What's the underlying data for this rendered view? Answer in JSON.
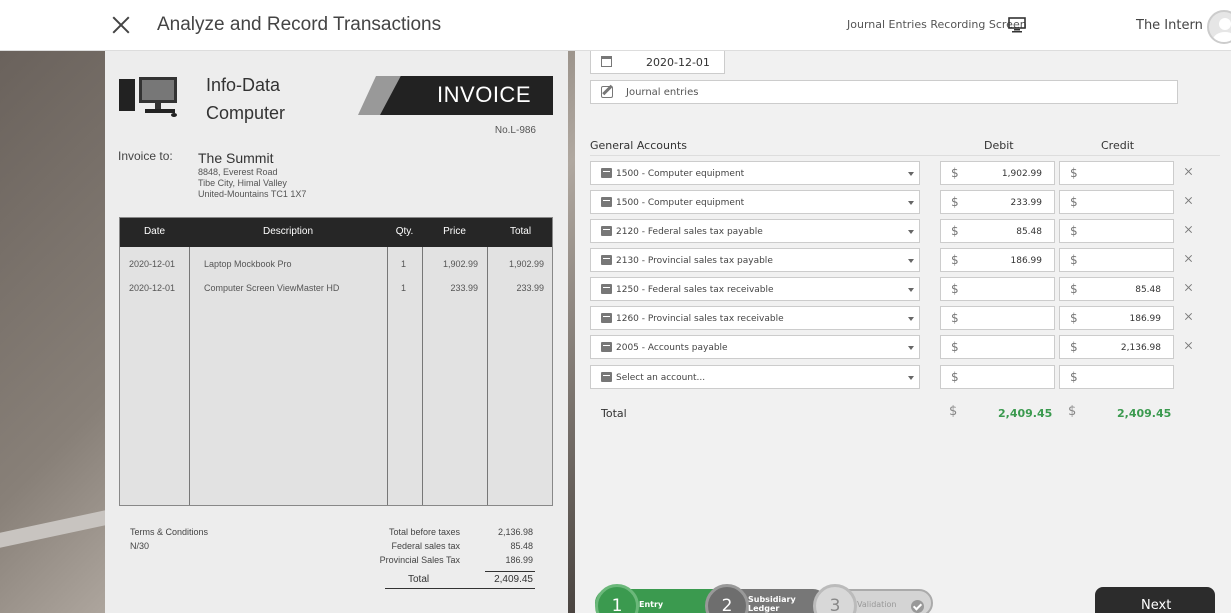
{
  "header": {
    "title": "Analyze and Record Transactions",
    "screen_label": "Journal Entries Recording Screen",
    "user_name": "The Intern"
  },
  "invoice": {
    "company_name": "Info-Data Computer",
    "banner": "INVOICE",
    "number": "No.L-986",
    "to_label": "Invoice to:",
    "to_name": "The Summit",
    "address": [
      "8848, Everest Road",
      "Tibe City, Himal Valley",
      "United-Mountains TC1 1X7"
    ],
    "columns": [
      "Date",
      "Description",
      "Qty.",
      "Price",
      "Total"
    ],
    "rows": [
      {
        "date": "2020-12-01",
        "description": "Laptop Mockbook Pro",
        "qty": "1",
        "price": "1,902.99",
        "total": "1,902.99"
      },
      {
        "date": "2020-12-01",
        "description": "Computer Screen ViewMaster HD",
        "qty": "1",
        "price": "233.99",
        "total": "233.99"
      }
    ],
    "terms_title": "Terms & Conditions",
    "terms": "N/30",
    "summary_labels": [
      "Total before taxes",
      "Federal sales tax",
      "Provincial Sales Tax"
    ],
    "summary_values": [
      "2,136.98",
      "85.48",
      "186.99"
    ],
    "total_label": "Total",
    "total_value": "2,409.45"
  },
  "entry": {
    "date": "2020-12-01",
    "description": "Journal entries",
    "col_accounts": "General Accounts",
    "col_debit": "Debit",
    "col_credit": "Credit",
    "currency": "$",
    "lines": [
      {
        "account": "1500 - Computer equipment",
        "debit": "1,902.99",
        "credit": ""
      },
      {
        "account": "1500 - Computer equipment",
        "debit": "233.99",
        "credit": ""
      },
      {
        "account": "2120 - Federal sales tax payable",
        "debit": "85.48",
        "credit": ""
      },
      {
        "account": "2130 - Provincial sales tax payable",
        "debit": "186.99",
        "credit": ""
      },
      {
        "account": "1250 - Federal sales tax receivable",
        "debit": "",
        "credit": "85.48"
      },
      {
        "account": "1260 - Provincial sales tax receivable",
        "debit": "",
        "credit": "186.99"
      },
      {
        "account": "2005 - Accounts payable",
        "debit": "",
        "credit": "2,136.98"
      }
    ],
    "empty_placeholder": "Select an account...",
    "total_label": "Total",
    "total_debit": "2,409.45",
    "total_credit": "2,409.45"
  },
  "stepper": {
    "steps": [
      {
        "number": "1",
        "label": "Entry"
      },
      {
        "number": "2",
        "label": "Subsidiary Ledger"
      },
      {
        "number": "3",
        "label": "Validation"
      }
    ]
  },
  "next_label": "Next",
  "colors": {
    "accent_green": "#3b9a4f",
    "dark": "#2c2c2c"
  }
}
